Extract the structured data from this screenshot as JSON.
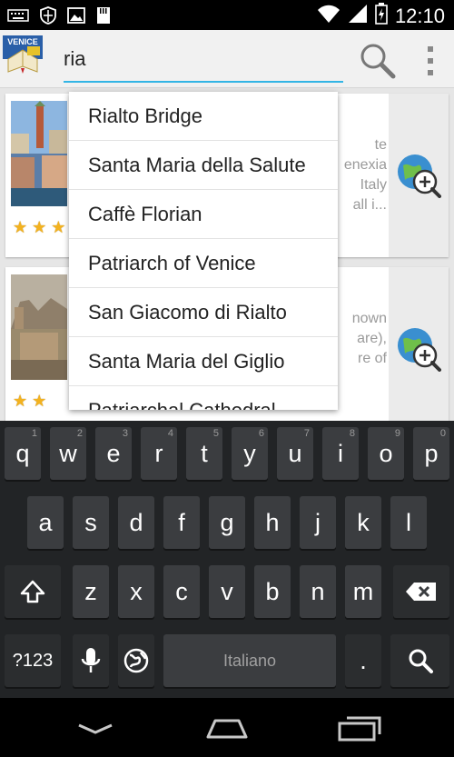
{
  "status_bar": {
    "time": "12:10",
    "icons": [
      "keyboard-icon",
      "shield-icon",
      "image-icon",
      "sd-card-icon",
      "wifi-icon",
      "signal-icon",
      "battery-charging-icon"
    ]
  },
  "action_bar": {
    "logo_text": "VENICE",
    "search": {
      "value": "ria",
      "placeholder": ""
    }
  },
  "cards": [
    {
      "stars": 3,
      "desc_lines": [
        "te",
        "enexia",
        "Italy",
        "all i..."
      ]
    },
    {
      "stars": 2,
      "desc_lines": [
        "nown",
        "are),",
        "re of"
      ]
    }
  ],
  "suggestions": [
    "Rialto Bridge",
    "Santa Maria della Salute",
    "Caffè Florian",
    "Patriarch of Venice",
    "San Giacomo di Rialto",
    "Santa Maria del Giglio",
    "Patriarchal Cathedral"
  ],
  "keyboard": {
    "row1": [
      {
        "label": "q",
        "hint": "1"
      },
      {
        "label": "w",
        "hint": "2"
      },
      {
        "label": "e",
        "hint": "3"
      },
      {
        "label": "r",
        "hint": "4"
      },
      {
        "label": "t",
        "hint": "5"
      },
      {
        "label": "y",
        "hint": "6"
      },
      {
        "label": "u",
        "hint": "7"
      },
      {
        "label": "i",
        "hint": "8"
      },
      {
        "label": "o",
        "hint": "9"
      },
      {
        "label": "p",
        "hint": "0"
      }
    ],
    "row2": [
      "a",
      "s",
      "d",
      "f",
      "g",
      "h",
      "j",
      "k",
      "l"
    ],
    "row3": [
      "z",
      "x",
      "c",
      "v",
      "b",
      "n",
      "m"
    ],
    "symbols_label": "?123",
    "space_label": "Italiano",
    "period_label": "."
  },
  "colors": {
    "accent": "#33b5e5",
    "star": "#f3b21f",
    "keyboard_bg": "#222426",
    "key_bg": "#3b3d40"
  }
}
